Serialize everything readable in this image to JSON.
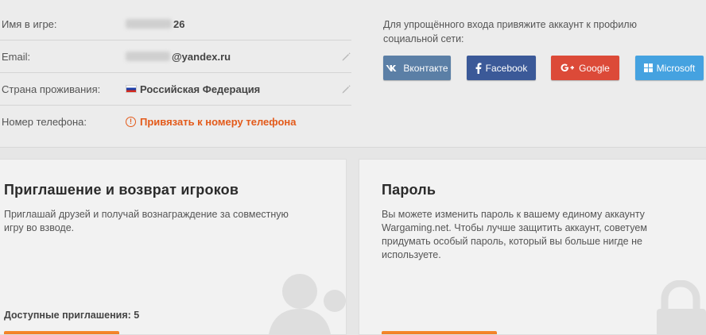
{
  "account": {
    "rows": [
      {
        "label": "Имя в игре:",
        "value_suffix": "26"
      },
      {
        "label": "Email:",
        "value_suffix": "@yandex.ru"
      },
      {
        "label": "Страна проживания:",
        "value": "Российская Федерация"
      },
      {
        "label": "Номер телефона:",
        "link": "Привязать к номеру телефона"
      }
    ]
  },
  "social": {
    "text": "Для упрощённого входа привяжите аккаунт к профилю социальной сети:",
    "buttons": [
      {
        "label": "Вконтакте",
        "icon": "vk-icon",
        "color": "#5b7fa6"
      },
      {
        "label": "Facebook",
        "icon": "facebook-icon",
        "color": "#3b5998"
      },
      {
        "label": "Google",
        "icon": "google-plus-icon",
        "color": "#dc4a38"
      },
      {
        "label": "Microsoft",
        "icon": "microsoft-icon",
        "color": "#45a2e0"
      }
    ]
  },
  "invite_card": {
    "title": "Приглашение и возврат игроков",
    "text": "Приглашай друзей и получай вознаграждение за совместную игру во взводе.",
    "available_label": "Доступные приглашения: 5"
  },
  "password_card": {
    "title": "Пароль",
    "text": "Вы можете изменить пароль к вашему единому аккаунту Wargaming.net. Чтобы лучше защитить аккаунт, советуем придумать особый пароль, который вы больше нигде не используете."
  },
  "colors": {
    "accent": "#e35a1a",
    "button_orange": "#f07a22"
  }
}
